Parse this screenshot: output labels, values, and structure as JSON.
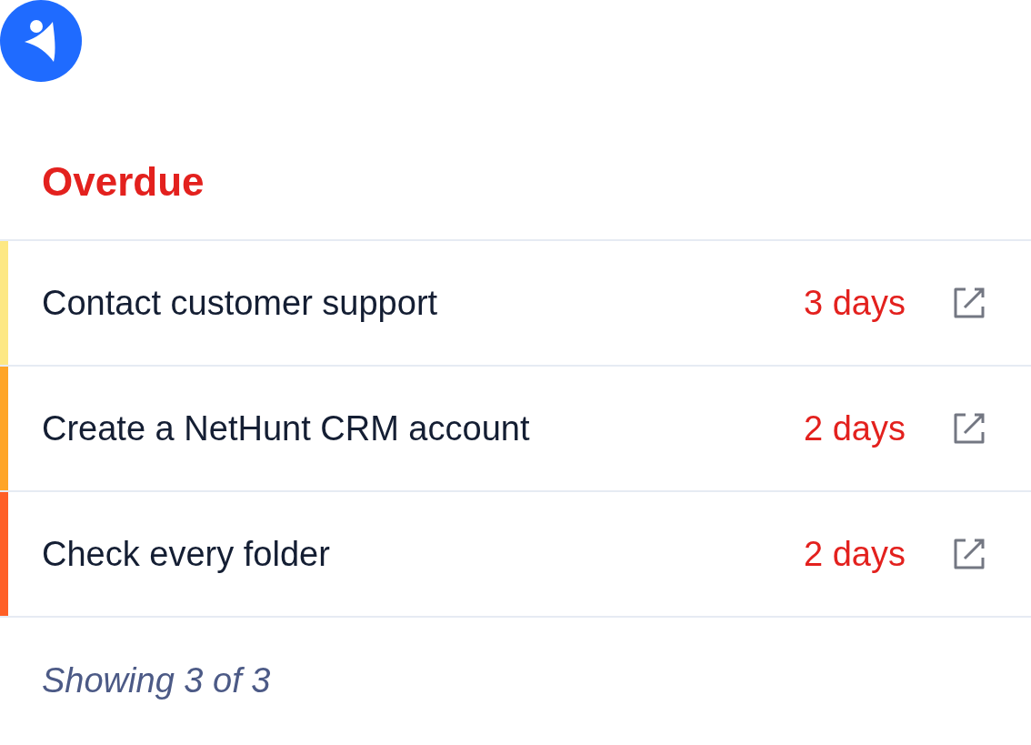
{
  "section": {
    "title": "Overdue"
  },
  "tasks": [
    {
      "title": "Contact customer support",
      "due": "3 days",
      "color": "#fde883"
    },
    {
      "title": "Create a NetHunt CRM account",
      "due": "2 days",
      "color": "#ffa526"
    },
    {
      "title": "Check every folder",
      "due": "2 days",
      "color": "#ff5f26"
    }
  ],
  "footer": "Showing 3 of 3"
}
